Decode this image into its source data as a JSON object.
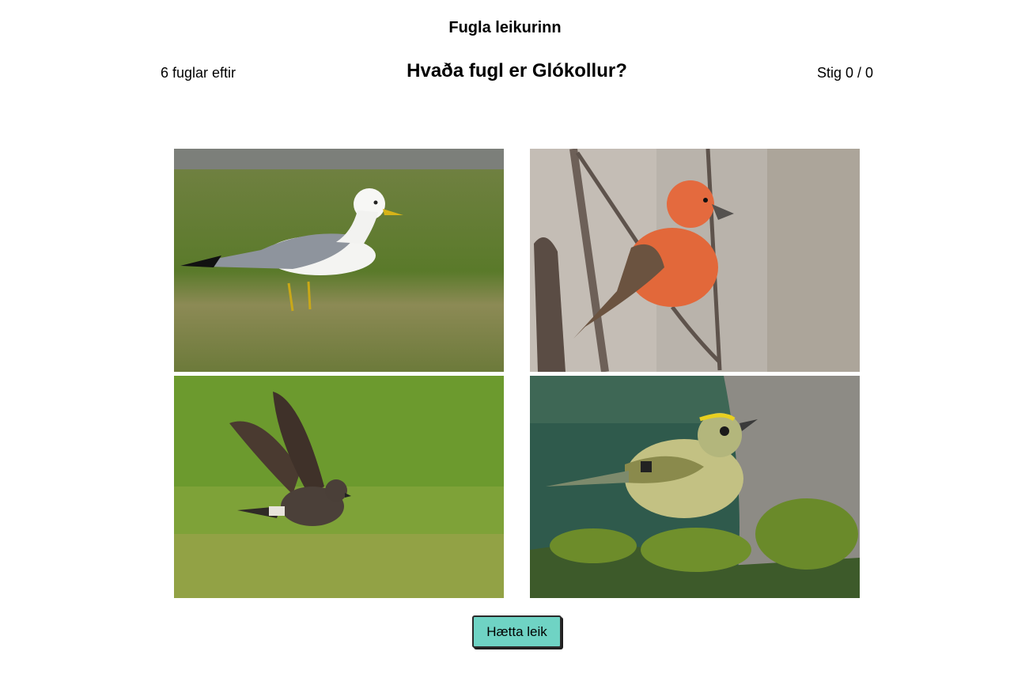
{
  "header": {
    "title": "Fugla leikurinn",
    "remaining": "6 fuglar eftir",
    "question": "Hvaða fugl er Glókollur?",
    "score": "Stig 0 / 0"
  },
  "choices": [
    {
      "subject": "gull",
      "background": "green grass"
    },
    {
      "subject": "red crossbill",
      "background": "bare branches"
    },
    {
      "subject": "dark storm petrel",
      "background": "green grass"
    },
    {
      "subject": "goldcrest",
      "background": "spruce branch"
    }
  ],
  "footer": {
    "quit_label": "Hætta leik"
  },
  "colors": {
    "button": "#6fd3c4",
    "background": "#ffffff"
  }
}
